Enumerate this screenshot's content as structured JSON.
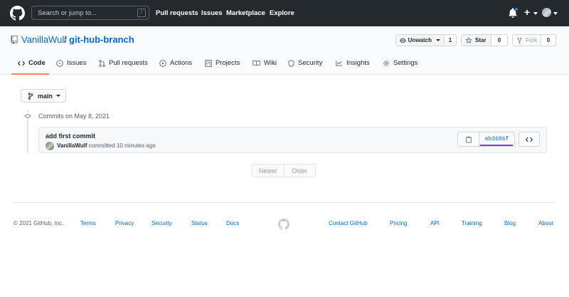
{
  "header": {
    "search_placeholder": "Search or jump to...",
    "search_shortcut": "/",
    "nav": [
      "Pull requests",
      "Issues",
      "Marketplace",
      "Explore"
    ],
    "plus_label": "+"
  },
  "repo": {
    "owner": "VanillaWulf",
    "separator": "/",
    "name": "git-hub-branch",
    "unwatch_label": "Unwatch",
    "watch_count": "1",
    "star_label": "Star",
    "star_count": "0",
    "fork_label": "Fork",
    "fork_count": "0"
  },
  "tabs": [
    "Code",
    "Issues",
    "Pull requests",
    "Actions",
    "Projects",
    "Wiki",
    "Security",
    "Insights",
    "Settings"
  ],
  "branch": {
    "name": "main"
  },
  "commits": {
    "date_heading": "Commits on May 8, 2021",
    "items": [
      {
        "message": "add first commit",
        "author": "VanillaWulf",
        "action": "committed",
        "time": "10 minutes ago",
        "sha": "eb3686f"
      }
    ]
  },
  "pagination": {
    "newer": "Newer",
    "older": "Older"
  },
  "footer": {
    "copyright": "© 2021 GitHub, Inc.",
    "links_left": [
      "Terms",
      "Privacy",
      "Security",
      "Status",
      "Docs"
    ],
    "links_right": [
      "Contact GitHub",
      "Pricing",
      "API",
      "Training",
      "Blog",
      "About"
    ]
  },
  "colors": {
    "header_bg": "#24292e",
    "link": "#0366d6",
    "active_tab_underline": "#f9826c",
    "sha_underline": "#8a3ecf",
    "notification_dot": "#2188ff"
  },
  "icons": [
    "github-logo-icon",
    "repo-icon",
    "eye-icon",
    "star-icon",
    "fork-icon",
    "code-icon",
    "issue-icon",
    "pull-request-icon",
    "play-icon",
    "project-icon",
    "book-icon",
    "shield-icon",
    "graph-icon",
    "gear-icon",
    "branch-icon",
    "commit-icon",
    "clipboard-icon",
    "bell-icon"
  ]
}
